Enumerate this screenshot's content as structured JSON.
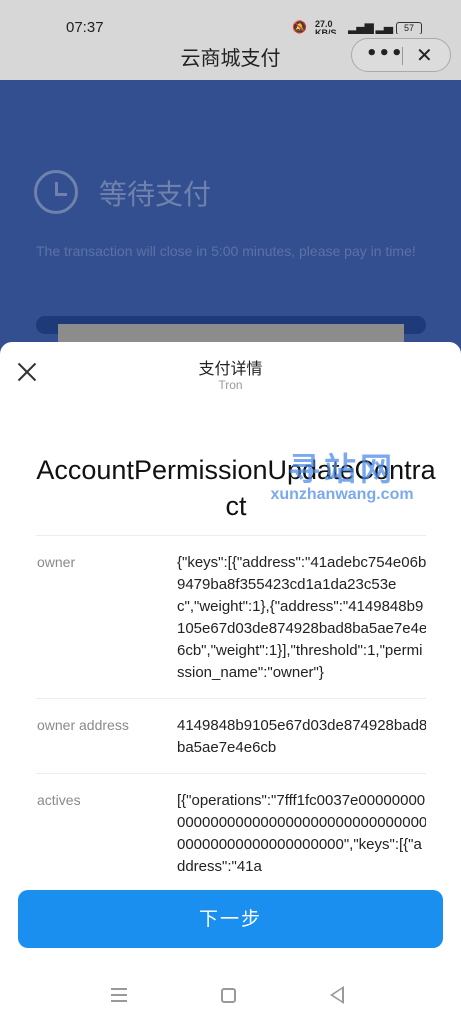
{
  "status_bar": {
    "time": "07:37",
    "net_speed": "27.0",
    "net_unit": "KB/S",
    "battery": "57"
  },
  "header": {
    "title": "云商城支付",
    "more_label": "•••",
    "close_label": "✕"
  },
  "background_page": {
    "status_title": "等待支付",
    "close_notice": "The transaction will close in 5:00  minutes, please pay in time!"
  },
  "sheet": {
    "title": "支付详情",
    "subtitle": "Tron",
    "contract_name": "AccountPermissionUpdateContract",
    "rows": [
      {
        "label": "owner",
        "value": "{\"keys\":[{\"address\":\"41adebc754e06b9479ba8f355423cd1a1da23c53ec\",\"weight\":1},{\"address\":\"4149848b9105e67d03de874928bad8ba5ae7e4e6cb\",\"weight\":1}],\"threshold\":1,\"permission_name\":\"owner\"}"
      },
      {
        "label": "owner address",
        "value": "4149848b9105e67d03de874928bad8ba5ae7e4e6cb"
      },
      {
        "label": "actives",
        "value": "[{\"operations\":\"7fff1fc0037e0000000000000000000000000000000000000000000000000000000000\",\"keys\":[{\"address\":\"41a"
      }
    ],
    "next_button": "下一步"
  },
  "watermark": {
    "main": "寻站网",
    "sub": "xunzhanwang.com"
  },
  "colors": {
    "primary": "#1a8ff0",
    "background_blue": "#334f8f",
    "sheet_bg": "#ffffff"
  }
}
